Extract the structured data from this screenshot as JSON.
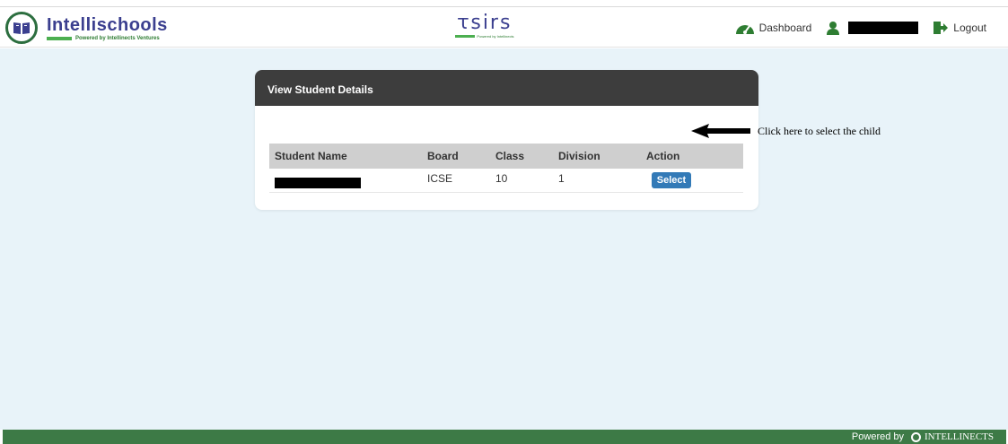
{
  "header": {
    "brand_name": "Intellischools",
    "brand_sub": "Powered by Intellinects Ventures",
    "center_logo": "ꚍsirs",
    "center_logo_sub": "Powered by Intellinects",
    "nav": {
      "dashboard": "Dashboard",
      "logout": "Logout"
    }
  },
  "panel": {
    "title": "View Student Details",
    "columns": [
      "Student Name",
      "Board",
      "Class",
      "Division",
      "Action"
    ],
    "rows": [
      {
        "board": "ICSE",
        "class": "10",
        "division": "1",
        "action": "Select"
      }
    ]
  },
  "annotation": "Click here to select the child",
  "footer": {
    "powered_by": "Powered by",
    "brand": "INTELLINECTS"
  },
  "colors": {
    "header_bar": "#3d3d3d",
    "select_button": "#337ab7",
    "footer": "#3d7a46",
    "background": "#e8f3f9"
  }
}
